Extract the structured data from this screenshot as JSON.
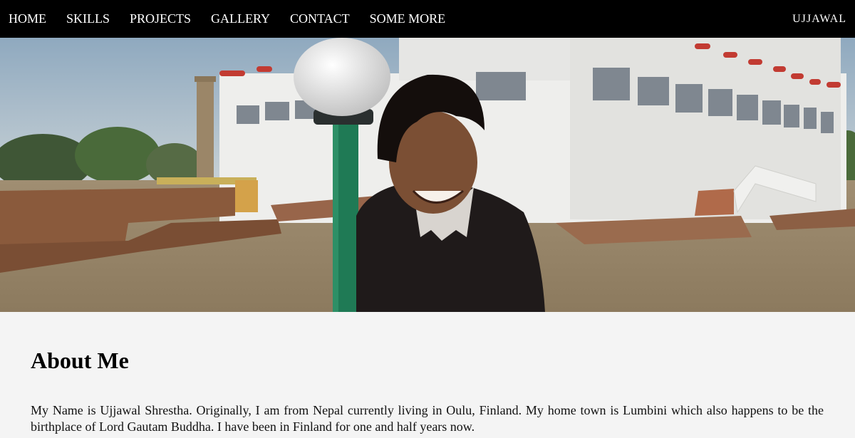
{
  "nav": {
    "links": [
      "HOME",
      "SKILLS",
      "PROJECTS",
      "GALLERY",
      "CONTACT",
      "SOME MORE"
    ],
    "brand": "UJJAWAL"
  },
  "hero": {
    "image": "photo-of-person-at-temple"
  },
  "about": {
    "heading": "About Me",
    "text": "My Name is Ujjawal Shrestha. Originally, I am from Nepal currently living in Oulu, Finland. My home town is Lumbini which also happens to be the birthplace of Lord Gautam Buddha. I have been in Finland for one and half years now."
  },
  "colors": {
    "nav_bg": "#000000",
    "page_bg": "#f4f4f4"
  }
}
